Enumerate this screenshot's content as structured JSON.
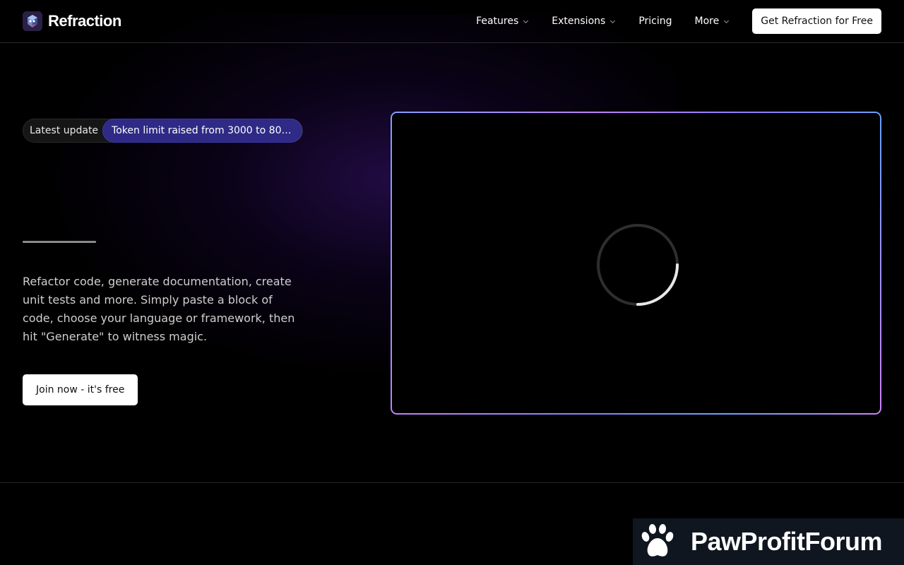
{
  "header": {
    "brand": "Refraction",
    "nav": [
      {
        "label": "Features",
        "has_dropdown": true
      },
      {
        "label": "Extensions",
        "has_dropdown": true
      },
      {
        "label": "Pricing",
        "has_dropdown": false
      },
      {
        "label": "More",
        "has_dropdown": true
      }
    ],
    "cta_label": "Get Refraction for Free"
  },
  "hero": {
    "update_label": "Latest update",
    "update_text": "Token limit raised from 3000 to 80…",
    "description": "Refactor code, generate documentation, create unit tests and more. Simply paste a block of code, choose your language or framework, then hit \"Generate\" to witness magic.",
    "join_label": "Join now - it's free"
  },
  "video": {
    "state": "loading"
  },
  "watermark": {
    "text": "PawProfitForum"
  },
  "colors": {
    "background": "#000000",
    "pill_accent": "#2e2a86",
    "frame_gradient_start": "#7fa0ff",
    "frame_gradient_end": "#d07fff"
  },
  "icons": [
    "refraction-logo-icon",
    "chevron-down-icon",
    "loading-spinner-icon",
    "paw-icon"
  ]
}
